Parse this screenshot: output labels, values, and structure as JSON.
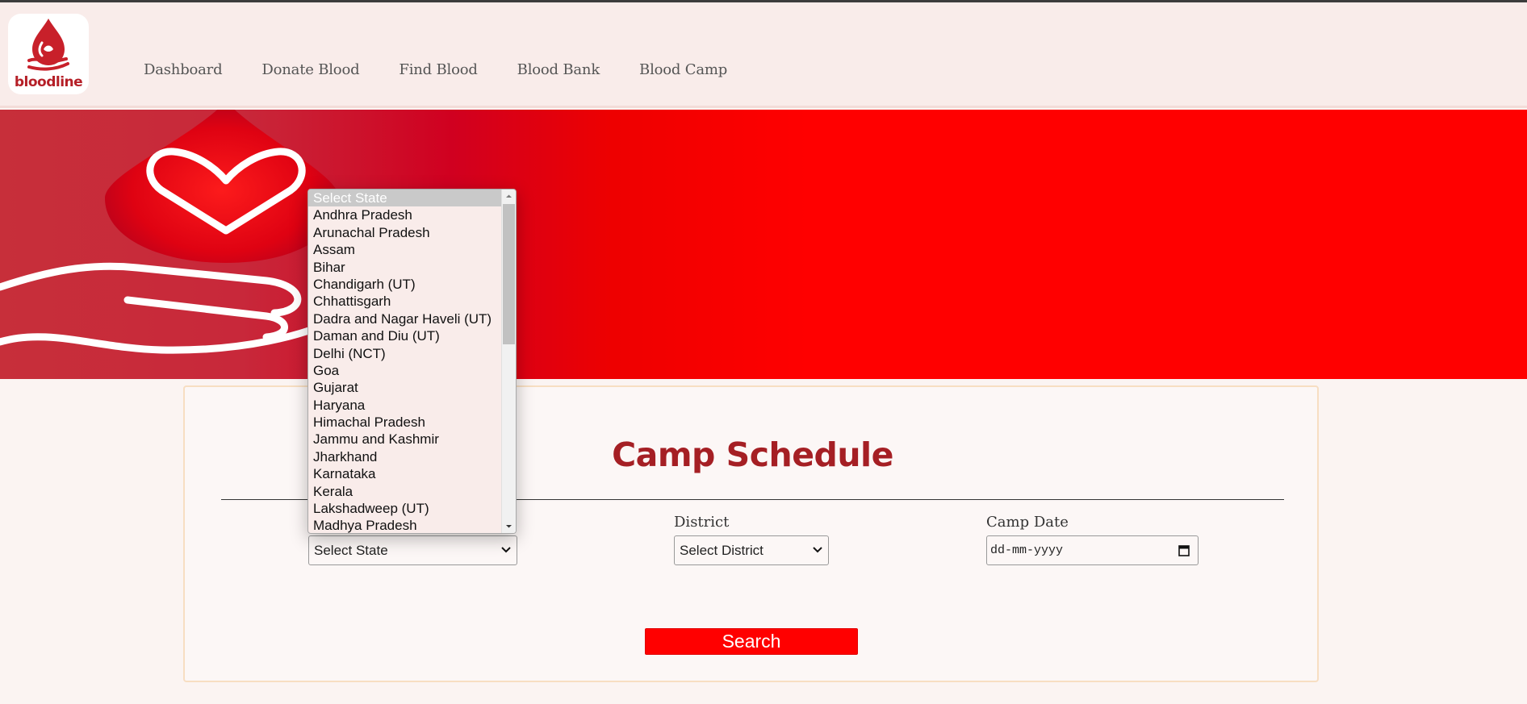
{
  "brand": {
    "logo_text": "bloodline"
  },
  "nav": {
    "items": [
      {
        "label": "Dashboard"
      },
      {
        "label": "Donate Blood"
      },
      {
        "label": "Find Blood"
      },
      {
        "label": "Blood Bank"
      },
      {
        "label": "Blood Camp"
      }
    ]
  },
  "camp": {
    "title": "Camp Schedule",
    "state_select": {
      "value": "Select State"
    },
    "district_label": "District",
    "district_select": {
      "value": "Select District"
    },
    "date_label": "Camp Date",
    "date_placeholder": "dd-mm-yyyy",
    "search_label": "Search"
  },
  "state_dropdown": {
    "options": [
      "Select State",
      "Andhra Pradesh",
      "Arunachal Pradesh",
      "Assam",
      "Bihar",
      "Chandigarh (UT)",
      "Chhattisgarh",
      "Dadra and Nagar Haveli (UT)",
      "Daman and Diu (UT)",
      "Delhi (NCT)",
      "Goa",
      "Gujarat",
      "Haryana",
      "Himachal Pradesh",
      "Jammu and Kashmir",
      "Jharkhand",
      "Karnataka",
      "Kerala",
      "Lakshadweep (UT)",
      "Madhya Pradesh"
    ],
    "selected_index": 0
  },
  "colors": {
    "accent": "#ff0000",
    "title": "#a51f24",
    "brand": "#b51f27",
    "header_bg": "#f9ecea"
  },
  "icons": {
    "logo": "blood-drop-hand-icon",
    "chevron": "chevron-down-icon",
    "calendar": "calendar-icon"
  }
}
